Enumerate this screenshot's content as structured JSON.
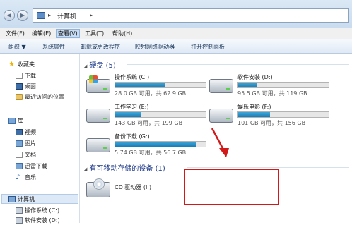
{
  "address": {
    "path": "计算机",
    "back": "◀",
    "forward": "▶"
  },
  "menu": [
    "文件(F)",
    "编辑(E)",
    "查看(V)",
    "工具(T)",
    "帮助(H)"
  ],
  "toolbar": {
    "organize": "组织 ▼",
    "system_props": "系统属性",
    "uninstall": "卸载或更改程序",
    "map_drive": "映射网络驱动器",
    "control_panel": "打开控制面板"
  },
  "sidebar": {
    "favorites": "收藏夹",
    "downloads": "下载",
    "desktop": "桌面",
    "recent": "最近访问的位置",
    "libraries": "库",
    "videos": "视频",
    "pictures": "图片",
    "documents": "文档",
    "xunlei": "迅雷下载",
    "music": "音乐",
    "computer": "计算机",
    "os_drive": "操作系统 (C:)",
    "soft_drive": "软件安装 (D:)"
  },
  "main": {
    "hdd_header": "硬盘 (5)",
    "removable_header": "有可移动存储的设备 (1)",
    "drives": [
      {
        "name": "操作系统 (C:)",
        "info": "28.0 GB 可用，共 62.9 GB",
        "used_pct": 55
      },
      {
        "name": "软件安装 (D:)",
        "info": "95.5 GB 可用，共 119 GB",
        "used_pct": 20
      },
      {
        "name": "工作学习 (E:)",
        "info": "143 GB 可用，共 199 GB",
        "used_pct": 28
      },
      {
        "name": "娱乐电影 (F:)",
        "info": "101 GB 可用，共 156 GB",
        "used_pct": 35
      },
      {
        "name": "备份下载 (G:)",
        "info": "5.74 GB 可用，共 56.7 GB",
        "used_pct": 90
      }
    ],
    "cd": {
      "name": "CD 驱动器 (I:)"
    }
  },
  "colors": {
    "annotation": "#d11919",
    "bar_fill": "#1c7cb6"
  }
}
